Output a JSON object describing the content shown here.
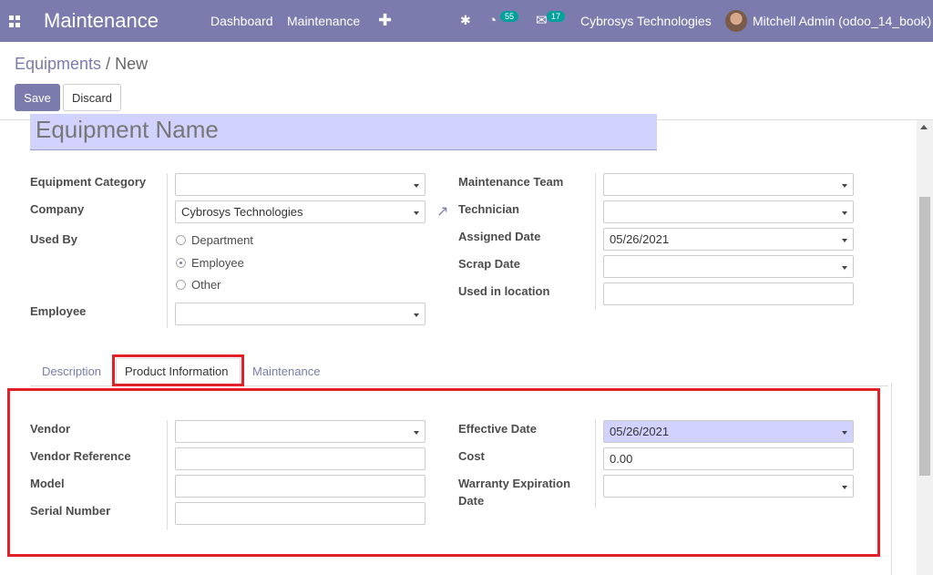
{
  "navbar": {
    "app_name": "Maintenance",
    "menu": [
      "Dashboard",
      "Maintenance"
    ],
    "plus": "✚",
    "activity_count": "55",
    "message_count": "17",
    "company": "Cybrosys Technologies",
    "user": "Mitchell Admin (odoo_14_book)",
    "accent": "#7c7bad"
  },
  "breadcrumb": {
    "parent": "Equipments",
    "sep": " / ",
    "current": "New"
  },
  "buttons": {
    "save": "Save",
    "discard": "Discard"
  },
  "form": {
    "name_placeholder": "Equipment Name",
    "left": {
      "equipment_category": {
        "label": "Equipment Category",
        "value": ""
      },
      "company": {
        "label": "Company",
        "value": "Cybrosys Technologies"
      },
      "used_by": {
        "label": "Used By",
        "options": [
          "Department",
          "Employee",
          "Other"
        ],
        "selected": "Employee"
      },
      "employee": {
        "label": "Employee",
        "value": ""
      }
    },
    "right": {
      "maintenance_team": {
        "label": "Maintenance Team",
        "value": ""
      },
      "technician": {
        "label": "Technician",
        "value": ""
      },
      "assigned_date": {
        "label": "Assigned Date",
        "value": "05/26/2021"
      },
      "scrap_date": {
        "label": "Scrap Date",
        "value": ""
      },
      "used_in_location": {
        "label": "Used in location",
        "value": ""
      }
    }
  },
  "tabs": [
    "Description",
    "Product Information",
    "Maintenance"
  ],
  "active_tab": "Product Information",
  "product_info": {
    "vendor": {
      "label": "Vendor",
      "value": ""
    },
    "vendor_reference": {
      "label": "Vendor Reference",
      "value": ""
    },
    "model": {
      "label": "Model",
      "value": ""
    },
    "serial_number": {
      "label": "Serial Number",
      "value": ""
    },
    "effective_date": {
      "label": "Effective Date",
      "value": "05/26/2021"
    },
    "cost": {
      "label": "Cost",
      "value": "0.00"
    },
    "warranty_expiration_date": {
      "label_line1": "Warranty Expiration",
      "label_line2": "Date",
      "value": ""
    }
  },
  "highlight_color": "#e2202a"
}
